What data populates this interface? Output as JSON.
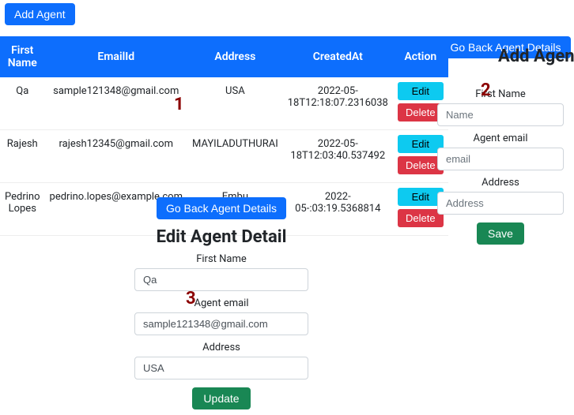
{
  "top": {
    "add_agent": "Add Agent"
  },
  "table": {
    "headers": {
      "first_name": "First Name",
      "email": "EmailId",
      "address": "Address",
      "created_at": "CreatedAt",
      "action": "Action"
    },
    "rows": [
      {
        "first_name": "Qa",
        "email": "sample121348@gmail.com",
        "address": "USA",
        "created_at": "2022-05-18T12:18:07.2316038"
      },
      {
        "first_name": "Rajesh",
        "email": "rajesh12345@gmail.com",
        "address": "MAYILADUTHURAI",
        "created_at": "2022-05-18T12:03:40.537492"
      },
      {
        "first_name": "Pedrino Lopes",
        "email": "pedrino.lopes@example.com",
        "address": "Embu",
        "created_at": "2022-05-:03:19.5368814"
      }
    ],
    "edit": "Edit",
    "delete": "Delete"
  },
  "edit_panel": {
    "go_back": "Go Back Agent Details",
    "heading": "Edit Agent Detail",
    "first_name_label": "First Name",
    "first_name_value": "Qa",
    "email_label": "Agent email",
    "email_value": "sample121348@gmail.com",
    "address_label": "Address",
    "address_value": "USA",
    "update": "Update"
  },
  "add_panel": {
    "go_back": "Go Back Agent Details",
    "heading": "Add Agent",
    "first_name_label": "First Name",
    "first_name_ph": "Name",
    "email_label": "Agent email",
    "email_ph": "email",
    "address_label": "Address",
    "address_ph": "Address",
    "save": "Save"
  },
  "annotations": {
    "one": "1",
    "two": "2",
    "three": "3"
  }
}
